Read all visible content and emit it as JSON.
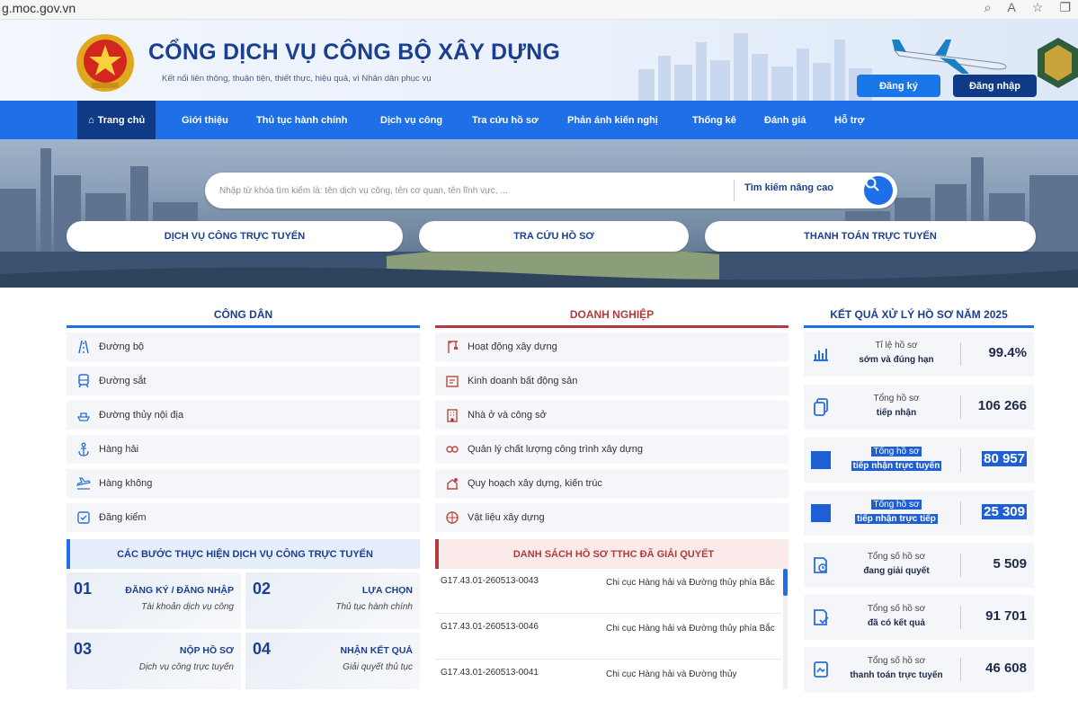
{
  "browser": {
    "url": "g.moc.gov.vn"
  },
  "header": {
    "title": "CỔNG DỊCH VỤ CÔNG BỘ XÂY DỰNG",
    "subtitle": "Kết nối liên thông, thuận tiện, thiết thực, hiệu quả, vì Nhân dân phục vụ",
    "register_label": "Đăng ký",
    "login_label": "Đăng nhập"
  },
  "nav": {
    "items": [
      "Trang chủ",
      "Giới thiệu",
      "Thủ tục hành chính",
      "Dịch vụ công",
      "Tra cứu hồ sơ",
      "Phản ánh kiến nghị",
      "Thống kê",
      "Đánh giá",
      "Hỗ trợ"
    ]
  },
  "search": {
    "placeholder": "Nhập từ khóa tìm kiếm là: tên dịch vụ công, tên cơ quan, tên lĩnh vực, ...",
    "advanced_label": "Tìm kiếm nâng cao"
  },
  "quick_links": [
    "DỊCH VỤ CÔNG TRỰC TUYẾN",
    "TRA CỨU HỒ SƠ",
    "THANH TOÁN TRỰC TUYẾN"
  ],
  "citizen": {
    "title": "CÔNG DÂN",
    "items": [
      "Đường bộ",
      "Đường sắt",
      "Đường thủy nội địa",
      "Hàng hải",
      "Hàng không",
      "Đăng kiểm"
    ]
  },
  "business": {
    "title": "DOANH NGHIỆP",
    "items": [
      "Hoạt động xây dựng",
      "Kinh doanh bất động sản",
      "Nhà ở và công sở",
      "Quản lý chất lượng công trình xây dựng",
      "Quy hoạch xây dựng, kiến trúc",
      "Vật liệu xây dựng"
    ]
  },
  "steps": {
    "title": "CÁC BƯỚC THỰC HIỆN DỊCH VỤ CÔNG TRỰC TUYẾN",
    "items": [
      {
        "num": "01",
        "title": "ĐĂNG KÝ / ĐĂNG NHẬP",
        "sub": "Tài khoản dịch vụ công"
      },
      {
        "num": "02",
        "title": "LỰA CHỌN",
        "sub": "Thủ tục hành chính"
      },
      {
        "num": "03",
        "title": "NỘP HỒ SƠ",
        "sub": "Dịch vụ công trực tuyến"
      },
      {
        "num": "04",
        "title": "NHẬN KẾT QUẢ",
        "sub": "Giải quyết thủ tục"
      }
    ]
  },
  "resolved": {
    "title": "DANH SÁCH HỒ SƠ TTHC ĐÃ GIẢI QUYẾT",
    "rows": [
      {
        "code": "G17.43.01-260513-0043",
        "agency": "Chi cục Hàng hải và Đường thủy phía Bắc"
      },
      {
        "code": "G17.43.01-260513-0046",
        "agency": "Chi cục Hàng hải và Đường thủy phía Bắc"
      },
      {
        "code": "G17.43.01-260513-0041",
        "agency": "Chi cục Hàng hải và Đường thủy"
      }
    ]
  },
  "results": {
    "title": "KẾT QUẢ XỬ LÝ HỒ SƠ NĂM 2025",
    "stats": [
      {
        "line1": "Tỉ lệ hồ sơ",
        "line2": "sớm và đúng hạn",
        "value": "99.4%"
      },
      {
        "line1": "Tổng hồ sơ",
        "line2": "tiếp nhận",
        "value": "106 266"
      },
      {
        "line1": "Tổng hồ sơ",
        "line2": "tiếp nhận trực tuyến",
        "value": "80 957"
      },
      {
        "line1": "Tổng hồ sơ",
        "line2": "tiếp nhận trực tiếp",
        "value": "25 309"
      },
      {
        "line1": "Tổng số hồ sơ",
        "line2": "đang giải quyết",
        "value": "5 509"
      },
      {
        "line1": "Tổng số hồ sơ",
        "line2": "đã có kết quả",
        "value": "91 701"
      },
      {
        "line1": "Tổng số hồ sơ",
        "line2": "thanh toán trực tuyến",
        "value": "46 608"
      }
    ]
  },
  "colors": {
    "primary": "#1e6fe8",
    "navy": "#0f3a86",
    "business_accent": "#b33b3b",
    "highlight": "#1e5fd4"
  }
}
